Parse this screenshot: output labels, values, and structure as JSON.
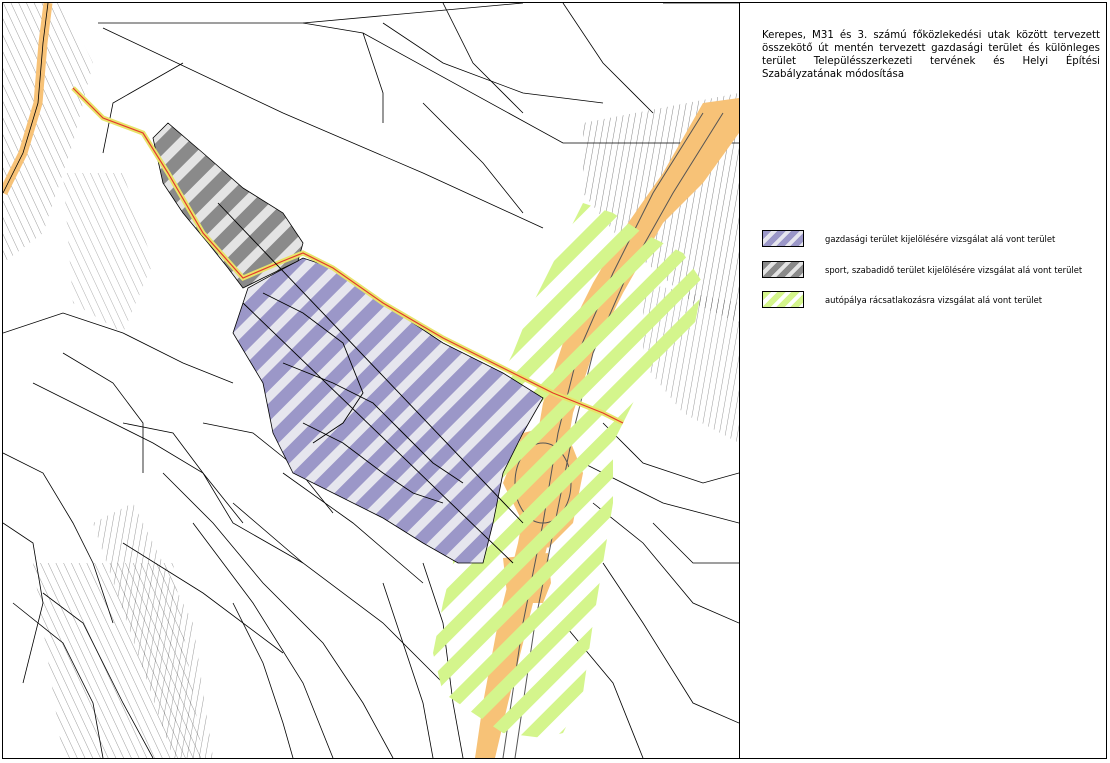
{
  "title": "Kerepes, M31 és 3. számú főközlekedési utak között tervezett összekötő út mentén tervezett gazdasági terület és különleges terület Településszerkezeti tervének és Helyi Építési Szabályzatának módosítása",
  "legend": [
    {
      "label": "gazdasági terület kijelölésére vizsgálat alá vont terület",
      "color": "#9b97c8",
      "stripe": "#e6e6ee",
      "name": "legend-economic"
    },
    {
      "label": "sport, szabadidő terület kijelölésére vizsgálat alá vont terület",
      "color": "#8a8a8a",
      "stripe": "#e4e4e4",
      "name": "legend-sport"
    },
    {
      "label": "autópálya rácsatlakozásra vizsgálat alá vont terület",
      "color": "#d4f58c",
      "stripe": "#ffffff",
      "name": "legend-motorway"
    }
  ],
  "colors": {
    "road": "#f7c277",
    "economic": "#9b97c8",
    "sport": "#8a8a8a",
    "motorway": "#d4f58c",
    "line": "#000000",
    "red_line": "#e53a2a"
  }
}
